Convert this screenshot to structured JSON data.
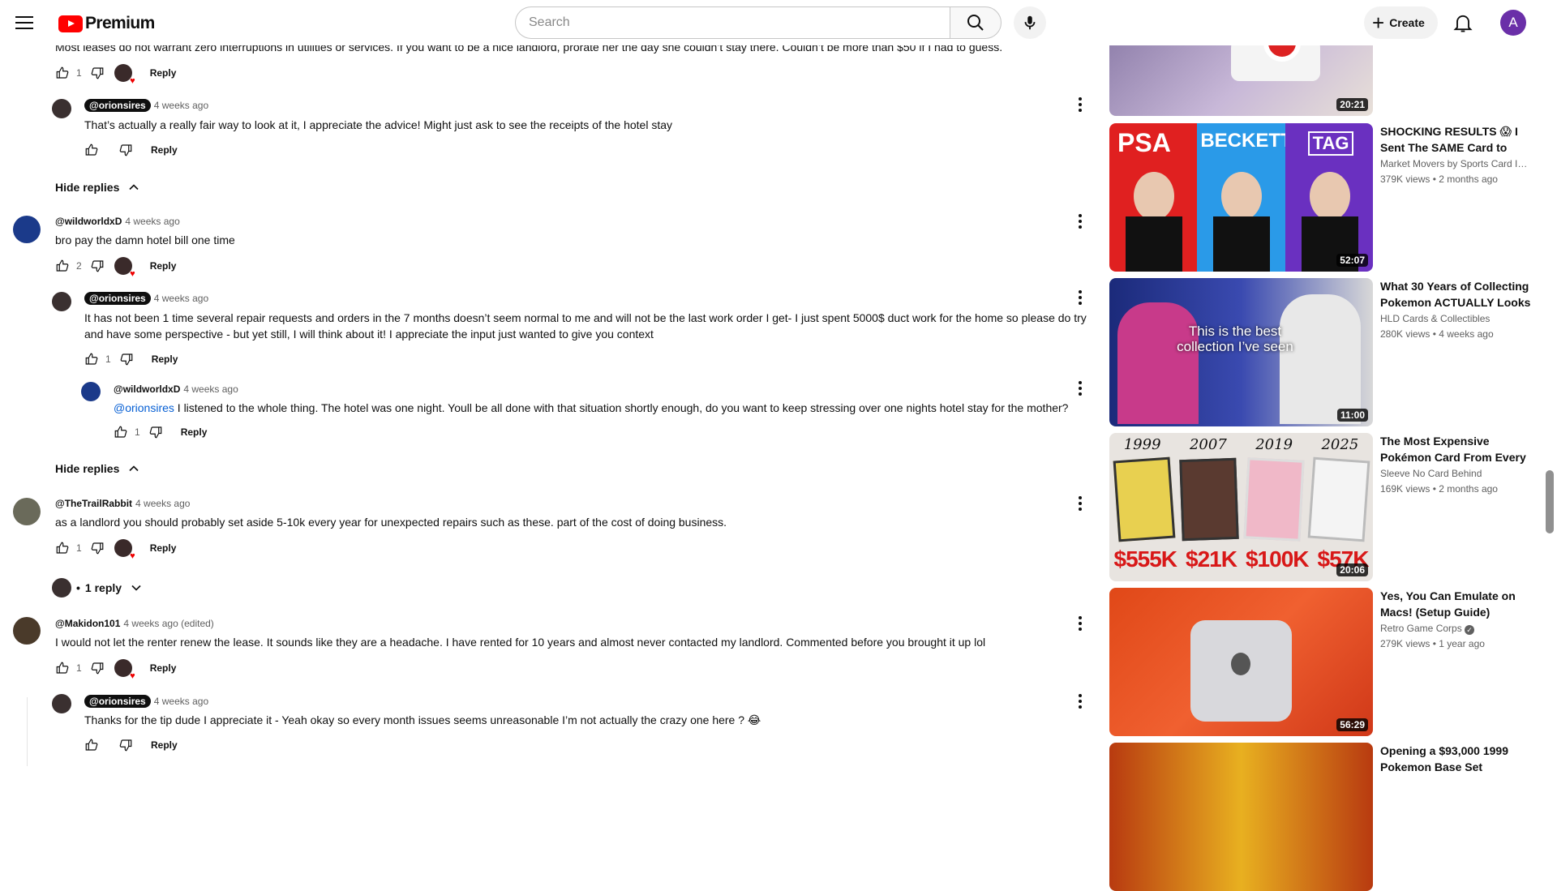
{
  "header": {
    "logo_text": "Premium",
    "search_placeholder": "Search",
    "create_label": "Create",
    "account_initial": "A"
  },
  "comments": [
    {
      "text": "Most leases do not warrant zero interruptions in utilities or services. If you want to be a nice landlord, prorate her the day she couldn’t stay there. Couldn’t be more than $50 if I had to guess.",
      "likes": "1",
      "reply_label": "Reply"
    },
    {
      "author": "@orionsires",
      "time": "4 weeks ago",
      "text": "That’s actually a really fair way to look at it, I appreciate the advice! Might just ask to see the receipts of the hotel stay",
      "reply_label": "Reply"
    },
    {
      "hide_replies": "Hide replies"
    },
    {
      "author": "@wildworldxD",
      "time": "4 weeks ago",
      "text": "bro pay the damn hotel bill one time",
      "likes": "2",
      "reply_label": "Reply"
    },
    {
      "author": "@orionsires",
      "time": "4 weeks ago",
      "text_line1": "It has not been 1 time several repair requests and orders in the 7 months doesn’t seem normal to me and will not be the last work order I get- I just spent 5000$ duct work for the home so please do try",
      "text_line2": "and have some perspective - but yet still, I will think about it! I appreciate the input just wanted to give you context",
      "likes": "1",
      "reply_label": "Reply"
    },
    {
      "author": "@wildworldxD",
      "time": "4 weeks ago",
      "mention": "@orionsires",
      "text": " I listened to the whole thing. The hotel was one night. Youll be all done with that situation shortly enough, do you want to keep stressing over one nights hotel stay for the mother?",
      "likes": "1",
      "reply_label": "Reply"
    },
    {
      "hide_replies": "Hide replies"
    },
    {
      "author": "@TheTrailRabbit",
      "time": "4 weeks ago",
      "text": "as a landlord you should probably set aside 5-10k every year for unexpected repairs such as these.  part of the cost of doing business.",
      "likes": "1",
      "reply_label": "Reply",
      "replies_label": "1 reply"
    },
    {
      "author": "@Makidon101",
      "time": "4 weeks ago (edited)",
      "text": "I would not let the renter renew the lease. It sounds like they are a headache. I have rented for 10 years and almost never contacted my landlord. Commented before you brought it up lol",
      "likes": "1",
      "reply_label": "Reply"
    },
    {
      "author": "@orionsires",
      "time": "4 weeks ago",
      "text": "Thanks for the tip dude I appreciate it - Yeah okay so every month issues seems unreasonable I’m not actually the crazy one here ? 😂",
      "reply_label": "Reply"
    }
  ],
  "videos": [
    {
      "duration": "20:21"
    },
    {
      "title": "SHOCKING RESULTS 😱 I Sent The SAME Card to FIV...",
      "channel": "Market Movers by Sports Card In...",
      "views": "379K views",
      "age": "2 months ago",
      "duration": "52:07",
      "thumb_labels": [
        "PSA",
        "BECKETT",
        "TAG"
      ]
    },
    {
      "title": "What 30 Years of Collecting Pokemon ACTUALLY Looks ...",
      "channel": "HLD Cards & Collectibles",
      "views": "280K views",
      "age": "4 weeks ago",
      "duration": "11:00",
      "thumb_caption": "This is the best collection I’ve seen"
    },
    {
      "title": "The Most Expensive Pokémon Card From Every ...",
      "channel": "Sleeve No Card Behind",
      "views": "169K views",
      "age": "2 months ago",
      "duration": "20:06",
      "thumb_years": [
        "1999",
        "2007",
        "2019",
        "2025"
      ],
      "thumb_prices": [
        "$555K",
        "$21K",
        "$100K",
        "$57K"
      ]
    },
    {
      "title": "Yes, You Can Emulate on Macs! (Setup Guide)",
      "channel": "Retro Game Corps",
      "views": "279K views",
      "age": "1 year ago",
      "duration": "56:29"
    },
    {
      "title": "Opening a $93,000 1999 Pokemon Base Set"
    }
  ],
  "colors": {
    "brand_red": "#ff0000",
    "link_blue": "#065fd4",
    "avatar_purple": "#6a2fa8"
  }
}
